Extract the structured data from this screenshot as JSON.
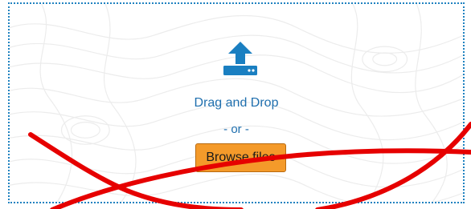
{
  "dropzone": {
    "icon": "upload-tray-icon",
    "drag_label": "Drag and Drop",
    "or_label": "- or -",
    "browse_label": "Browse files"
  },
  "colors": {
    "accent": "#1f82c0",
    "text": "#1f6fae",
    "button": "#f49a2a",
    "annotation": "#e60000"
  }
}
